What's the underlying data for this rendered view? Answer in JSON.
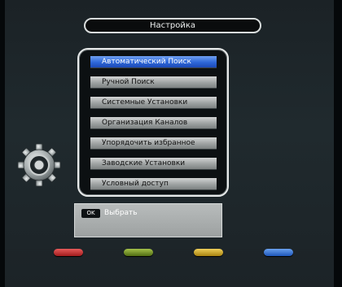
{
  "header": {
    "title": "Настройка"
  },
  "menu": {
    "items": [
      {
        "label": "Автоматический Поиск"
      },
      {
        "label": "Ручной Поиск"
      },
      {
        "label": "Системные Установки"
      },
      {
        "label": "Организация Каналов"
      },
      {
        "label": "Упорядочить избранное"
      },
      {
        "label": "Заводские Установки"
      },
      {
        "label": "Условный доступ"
      }
    ],
    "selected_index": 0
  },
  "side_icon": "gear-icon",
  "hint": {
    "key": "OK",
    "text": "Выбрать"
  },
  "color_keys": [
    {
      "name": "red-key",
      "color": "#c0282a"
    },
    {
      "name": "green-key",
      "color": "#6a8a1c"
    },
    {
      "name": "yellow-key",
      "color": "#c8a21a"
    },
    {
      "name": "blue-key",
      "color": "#2c6ed2"
    }
  ],
  "colors": {
    "selection": "#2e67d8"
  }
}
